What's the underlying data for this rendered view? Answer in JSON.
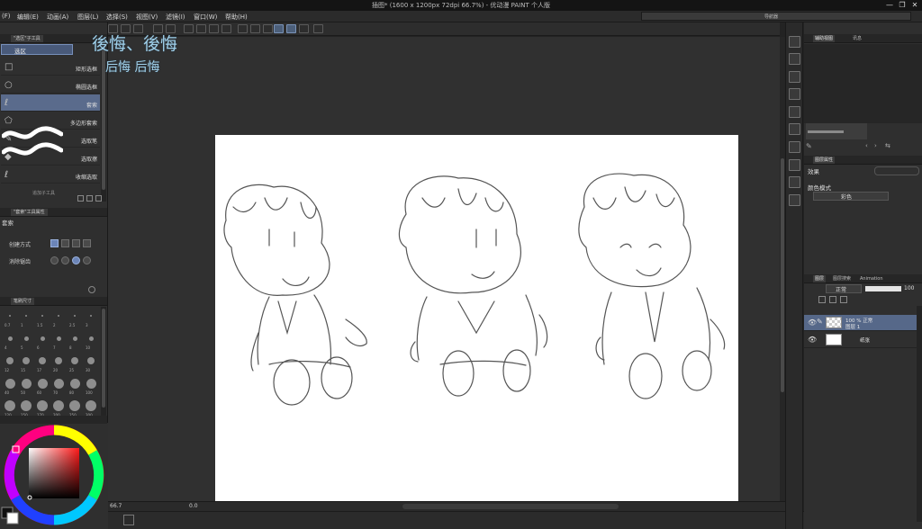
{
  "window": {
    "title": "插图* (1600 x 1200px 72dpi 66.7%) - 优动漫 PAINT 个人版",
    "controls": [
      "—",
      "❐",
      "✕"
    ],
    "secondary_title": "导航器"
  },
  "menu": {
    "items": [
      "(F)",
      "编辑(E)",
      "动画(A)",
      "图层(L)",
      "选择(S)",
      "视图(V)",
      "滤镜(I)",
      "窗口(W)",
      "帮助(H)"
    ]
  },
  "overlay": {
    "line1": "後悔、後悔",
    "line2": "后悔 后悔"
  },
  "left_panel": {
    "subtool_tab": "\"选区\"子工具",
    "group_label": "选区",
    "subtools": [
      {
        "label": "矩形选框",
        "icon": "□"
      },
      {
        "label": "椭圆选框",
        "icon": "○"
      },
      {
        "label": "套索",
        "icon": "ℓ",
        "selected": true
      },
      {
        "label": "多边形套索",
        "icon": "⬠"
      },
      {
        "label": "选取笔",
        "icon": "✎"
      },
      {
        "label": "选取擦",
        "icon": "◆"
      },
      {
        "label": "收缩选取",
        "icon": "ℓ"
      }
    ],
    "more_label": "追加子工具",
    "props_tab": "\"套索\"工具属性",
    "props_title": "套索",
    "creation_label": "创建方式",
    "antialias_label": "消除锯齿",
    "brush_tab": "笔刷尺寸",
    "brush_sizes": [
      "0.7",
      "1",
      "1.5",
      "2",
      "2.5",
      "3",
      "4",
      "5",
      "6",
      "7",
      "8",
      "10",
      "12",
      "15",
      "17",
      "20",
      "25",
      "30",
      "40",
      "50",
      "60",
      "70",
      "80",
      "100",
      "120",
      "150",
      "170",
      "200",
      "250",
      "300"
    ]
  },
  "status": {
    "zoom": "66.7",
    "angle": "0.0"
  },
  "right_panel": {
    "navigator_tab": "辅助视图",
    "navigator_tab2": "讯息",
    "navigator_tab3": "",
    "color_props_tab": "图层属性",
    "effect_label": "效果",
    "color_mode_label": "颜色模式",
    "color_mode_value": "彩色",
    "layer_tabs": [
      "图层",
      "图层搜索",
      "Animation"
    ],
    "blend_mode": "正常",
    "opacity": "100",
    "layers": [
      {
        "name_line1": "100 % 正常",
        "name_line2": "图层 1",
        "selected": true
      },
      {
        "name_line1": "纸张",
        "name_line2": "",
        "selected": false
      }
    ]
  },
  "colors": {
    "accent": "#5a6b8c",
    "overlay_text": "#9fd0ea",
    "canvas_bg": "#303030",
    "paper": "#ffffff"
  }
}
